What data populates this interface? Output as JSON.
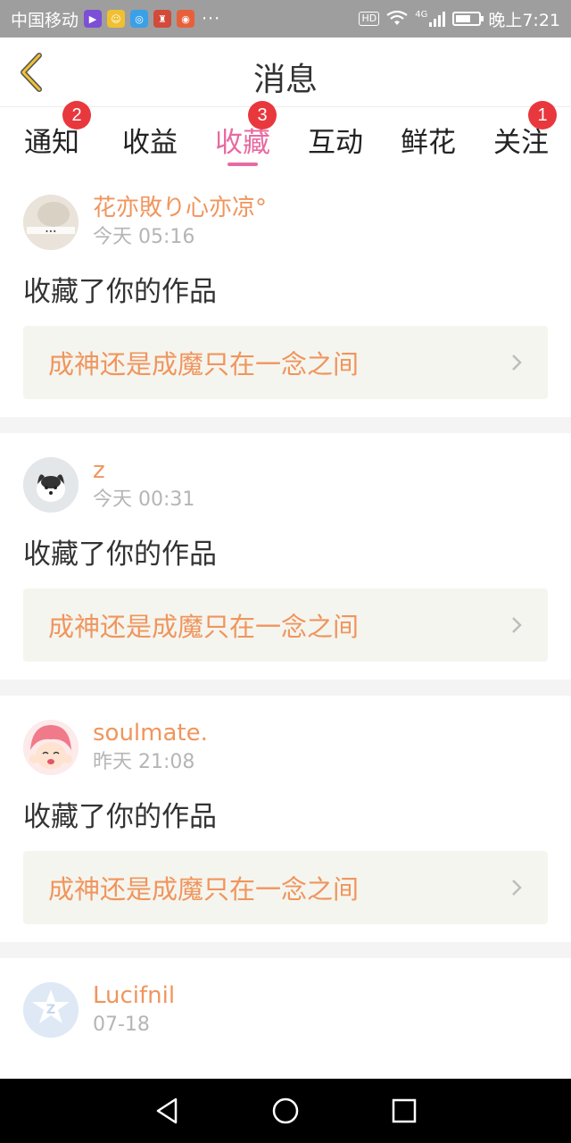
{
  "status_bar": {
    "carrier": "中国移动",
    "more": "···",
    "network": "HD",
    "network_type": "4G",
    "time": "晚上7:21",
    "app_icons": [
      "video-app-icon",
      "bilibili-icon",
      "map-icon",
      "game-icon",
      "weibo-icon"
    ]
  },
  "header": {
    "title": "消息",
    "back_icon": "chevron-left-icon",
    "accent_color": "#e86aa0"
  },
  "tabs": [
    {
      "label": "通知",
      "badge": "2",
      "active": false
    },
    {
      "label": "收益",
      "badge": "",
      "active": false
    },
    {
      "label": "收藏",
      "badge": "3",
      "active": true
    },
    {
      "label": "互动",
      "badge": "",
      "active": false
    },
    {
      "label": "鲜花",
      "badge": "",
      "active": false
    },
    {
      "label": "关注",
      "badge": "1",
      "active": false
    }
  ],
  "feed": [
    {
      "username": "花亦敗り心亦凉°",
      "time": "今天 05:16",
      "action": "收藏了你的作品",
      "work_title": "成神还是成魔只在一念之间"
    },
    {
      "username": "z",
      "time": "今天 00:31",
      "action": "收藏了你的作品",
      "work_title": "成神还是成魔只在一念之间"
    },
    {
      "username": "soulmate.",
      "time": "昨天 21:08",
      "action": "收藏了你的作品",
      "work_title": "成神还是成魔只在一念之间"
    },
    {
      "username": "Lucifnil",
      "time": "07-18",
      "action": "",
      "work_title": ""
    }
  ],
  "colors": {
    "username": "#f0955d",
    "badge": "#e8383d",
    "card_bg": "#f5f5ef"
  },
  "navbar": {
    "back": "back-triangle-icon",
    "home": "home-circle-icon",
    "recents": "recents-square-icon"
  }
}
